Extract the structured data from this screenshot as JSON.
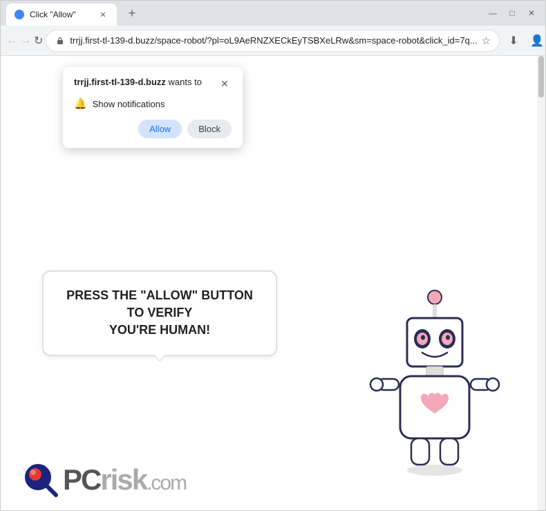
{
  "window": {
    "title": "Click \"Allow\"",
    "tab_title": "Click \"Allow\"",
    "new_tab_icon": "+",
    "minimize": "—",
    "maximize": "□",
    "close": "✕"
  },
  "nav": {
    "back_icon": "←",
    "forward_icon": "→",
    "reload_icon": "↻",
    "address": "trrjj.first-tl-139-d.buzz/space-robot/?pl=oL9AeRNZXECkEyTSBXeLRw&sm=space-robot&click_id=7q...",
    "bookmark_icon": "☆",
    "download_icon": "⬇",
    "account_icon": "👤",
    "menu_icon": "⋮"
  },
  "popup": {
    "domain_prefix": "",
    "domain": "trrjj.first-tl-139-d.buzz",
    "domain_suffix": " wants to",
    "close_icon": "✕",
    "notification_label": "Show notifications",
    "allow_label": "Allow",
    "block_label": "Block"
  },
  "page": {
    "message_line1": "PRESS THE \"ALLOW\" BUTTON TO VERIFY",
    "message_line2": "YOU'RE HUMAN!",
    "logo_text": "PC",
    "logo_text2": "risk",
    "logo_suffix": ".com"
  }
}
